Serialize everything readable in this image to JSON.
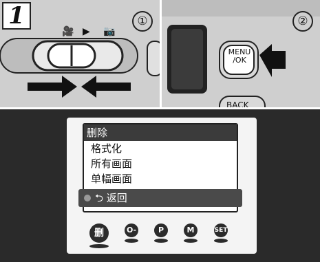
{
  "step": {
    "number": "1"
  },
  "callouts": {
    "one": "①",
    "two": "②"
  },
  "mode_icons": [
    "🎥",
    "▶",
    "📷"
  ],
  "camera_buttons": {
    "menu_ok": "MENU\n/OK",
    "back": "BACK"
  },
  "menu": {
    "title": "删除",
    "items": [
      "格式化",
      "所有画面",
      "单幅画面"
    ],
    "selected_item": "返回"
  },
  "icons": {
    "delete": "删",
    "protect": "O-",
    "print": "P",
    "voice": "M",
    "set": "SET"
  }
}
